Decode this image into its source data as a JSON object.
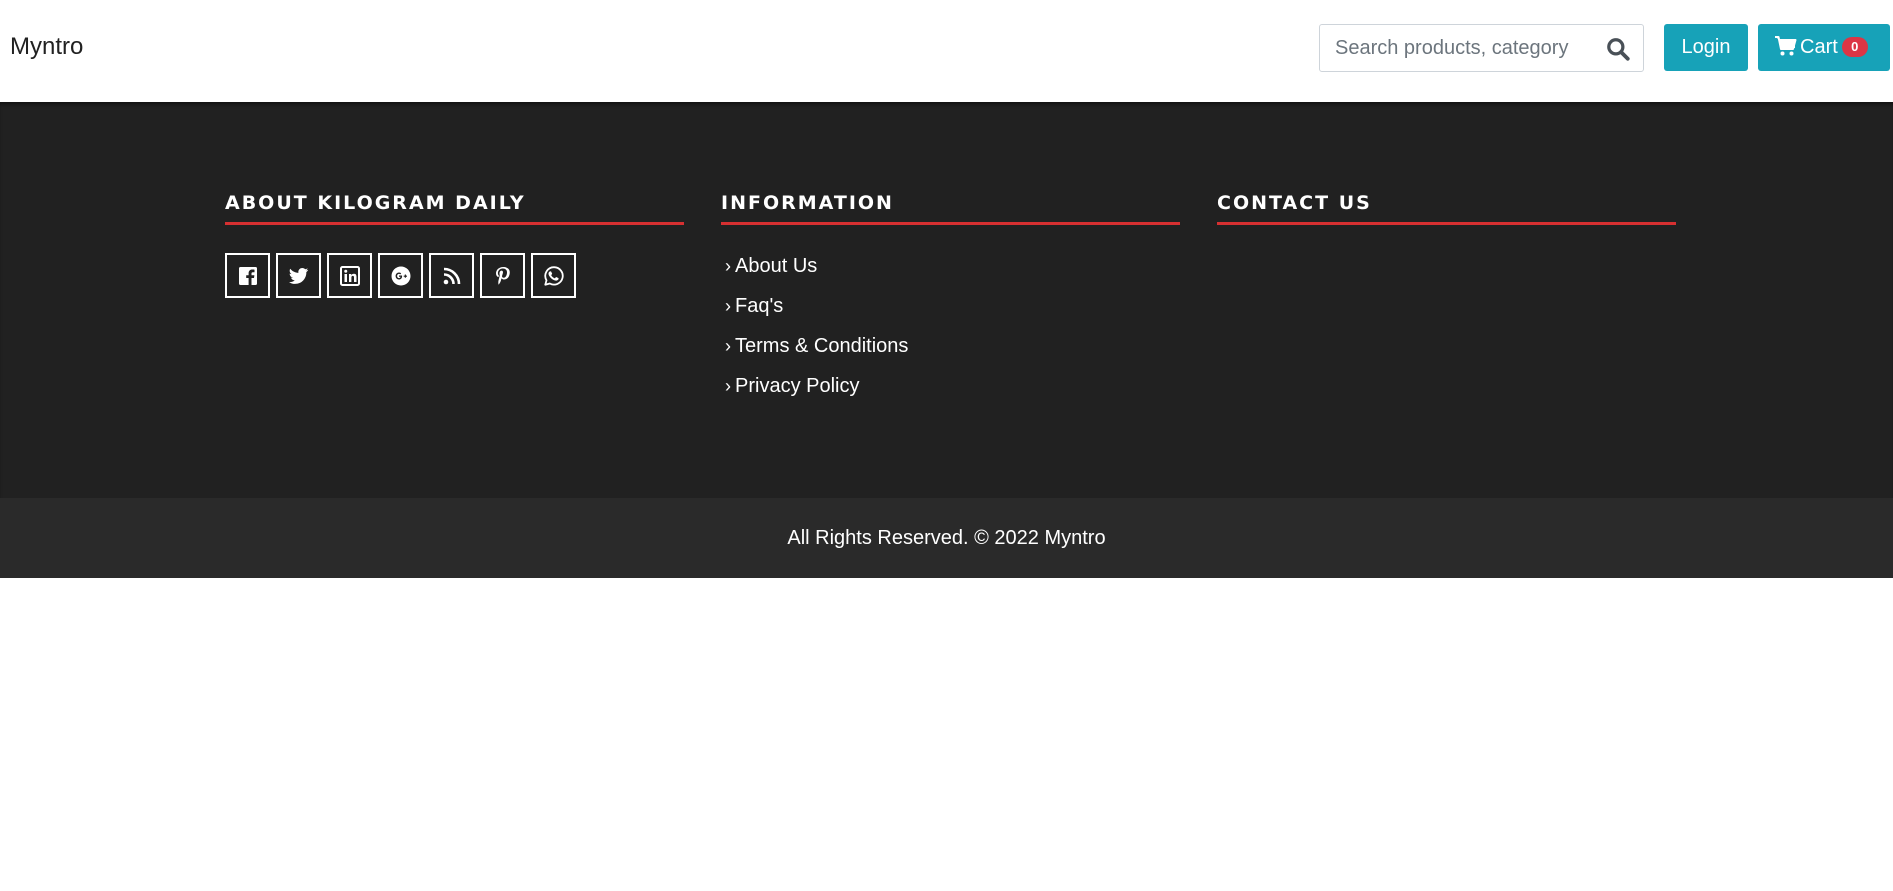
{
  "brand": "Myntro",
  "search": {
    "placeholder": "Search products, category"
  },
  "header": {
    "login_label": "Login",
    "cart_label": "Cart",
    "cart_count": "0"
  },
  "footer": {
    "about": {
      "title": "ABOUT KILOGRAM DAILY",
      "social_icons": [
        "facebook-icon",
        "twitter-icon",
        "linkedin-icon",
        "google-plus-icon",
        "rss-icon",
        "pinterest-icon",
        "whatsapp-icon"
      ]
    },
    "information": {
      "title": "INFORMATION",
      "links": [
        "About Us",
        "Faq's",
        "Terms & Conditions",
        "Privacy Policy"
      ]
    },
    "contact": {
      "title": "CONTACT US"
    },
    "copyright": "All Rights Reserved. © 2022 Myntro"
  },
  "colors": {
    "accent": "#17a2b8",
    "badge": "#dc3545",
    "footer_bg": "#212121",
    "footer_bottom_bg": "#2a2a2a",
    "underline": "#d63031"
  }
}
